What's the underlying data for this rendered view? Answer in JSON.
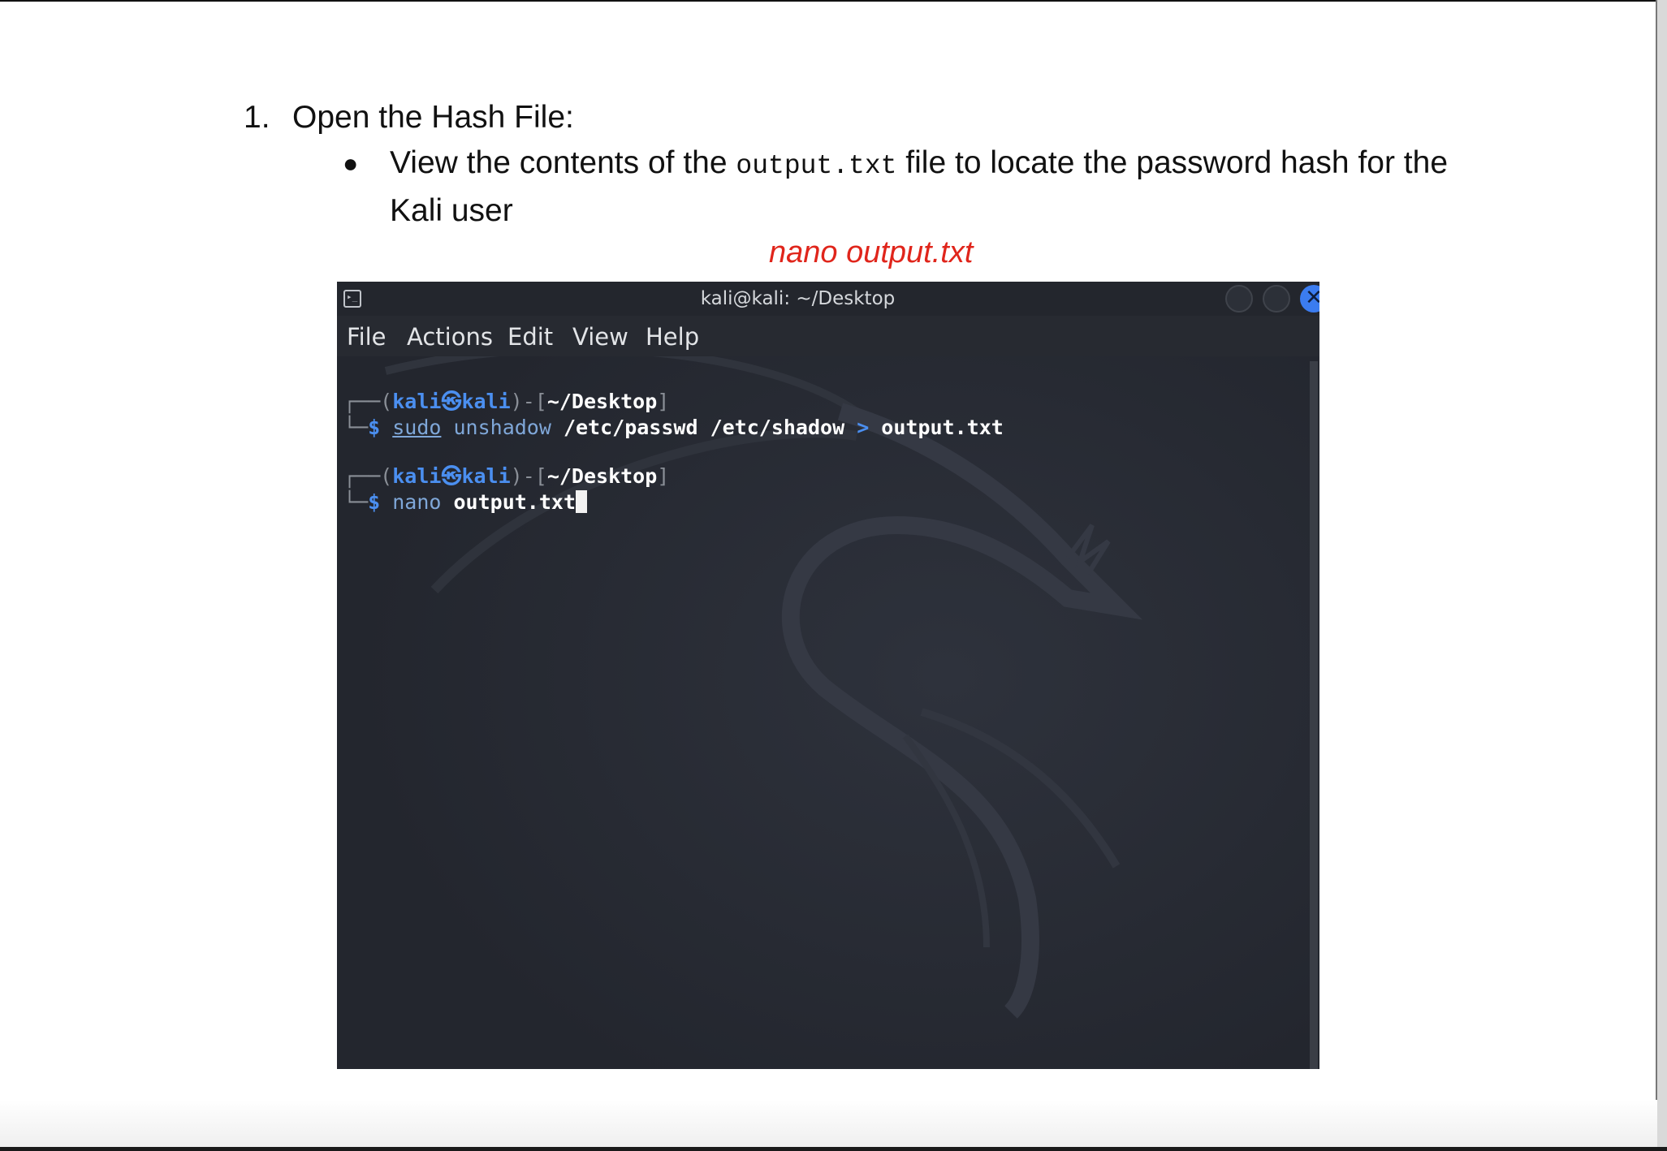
{
  "doc": {
    "list_number": "1.",
    "list_title": "Open the Hash File:",
    "bullet_symbol": "●",
    "bullet_text_1": "View the contents of the ",
    "bullet_code": "output.txt",
    "bullet_text_2": " file to locate the password hash for the Kali user",
    "caption": "nano output.txt"
  },
  "terminal": {
    "title": "kali@kali: ~/Desktop",
    "close_glyph": "✕",
    "menu": [
      "File",
      "Actions",
      "Edit",
      "View",
      "Help"
    ],
    "prompt1": {
      "frame_top": "┌──(",
      "user": "kali",
      "at": "㉿",
      "host": "kali",
      "mid": ")-[",
      "path": "~/Desktop",
      "end": "]",
      "frame_bottom": "└─",
      "dollar": "$ ",
      "cmd_sudo": "sudo",
      "cmd_name": " unshadow ",
      "cmd_args": "/etc/passwd /etc/shadow ",
      "redirect": "> ",
      "target": "output.txt"
    },
    "prompt2": {
      "frame_top": "┌──(",
      "user": "kali",
      "at": "㉿",
      "host": "kali",
      "mid": ")-[",
      "path": "~/Desktop",
      "end": "]",
      "frame_bottom": "└─",
      "dollar": "$ ",
      "cmd_name": "nano ",
      "target": "output.txt"
    },
    "colors": {
      "background": "#262a33",
      "prompt_blue": "#4b8ff0",
      "close_button": "#3b7cf0",
      "caption_red": "#e0251b"
    }
  }
}
